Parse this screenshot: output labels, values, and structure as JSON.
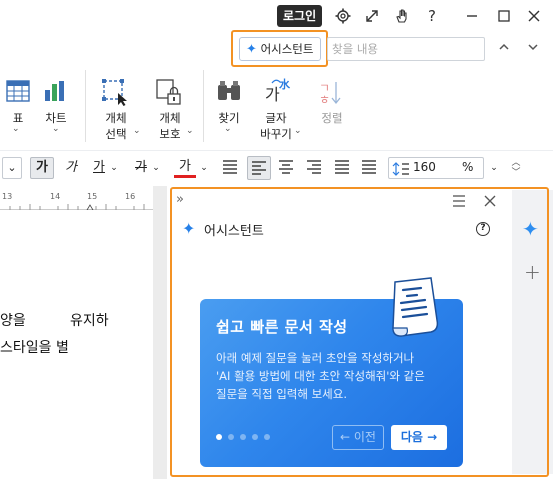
{
  "titlebar": {
    "login_label": "로그인",
    "icons": [
      "gear-icon",
      "expand-icon",
      "hand-icon",
      "help-icon",
      "minimize-icon",
      "maximize-icon",
      "close-icon"
    ]
  },
  "search": {
    "assistant_label": "어시스턴트",
    "placeholder": "찾을 내용"
  },
  "ribbon": {
    "table_label": "표",
    "chart_label": "차트",
    "select_object_line1": "개체",
    "select_object_line2": "선택",
    "protect_object_line1": "개체",
    "protect_object_line2": "보호",
    "find_label": "찾기",
    "char_change_line1": "글자",
    "char_change_line2": "바꾸기",
    "sort_label": "정렬"
  },
  "format": {
    "ga_bold": "가",
    "ga_italic": "가",
    "ga_underline": "가",
    "ga_strike": "가",
    "ga_color": "가",
    "line_spacing": "160",
    "unit": "%"
  },
  "ruler": {
    "ticks": [
      "13",
      "14",
      "15",
      "16"
    ]
  },
  "document": {
    "line1_left": "양을",
    "line1_right": "유지하",
    "line2": "스타일을 별"
  },
  "assistant_pane": {
    "title": "어시스턴트",
    "card_title": "쉽고 빠른 문서 작성",
    "card_body_1": "아래 예제 질문을 눌러 초안을 작성하거나",
    "card_body_2": "'AI 활용 방법에 대한 초안 작성해줘'와 같은",
    "card_body_3": "질문을 직접 입력해 보세요.",
    "prev_label": "← 이전",
    "next_label": "다음 →",
    "page_dots": 5,
    "active_dot": 1
  },
  "colors": {
    "highlight": "#f39224",
    "accent": "#2680e8",
    "card_start": "#4a9df0",
    "card_end": "#1c6ee0"
  }
}
